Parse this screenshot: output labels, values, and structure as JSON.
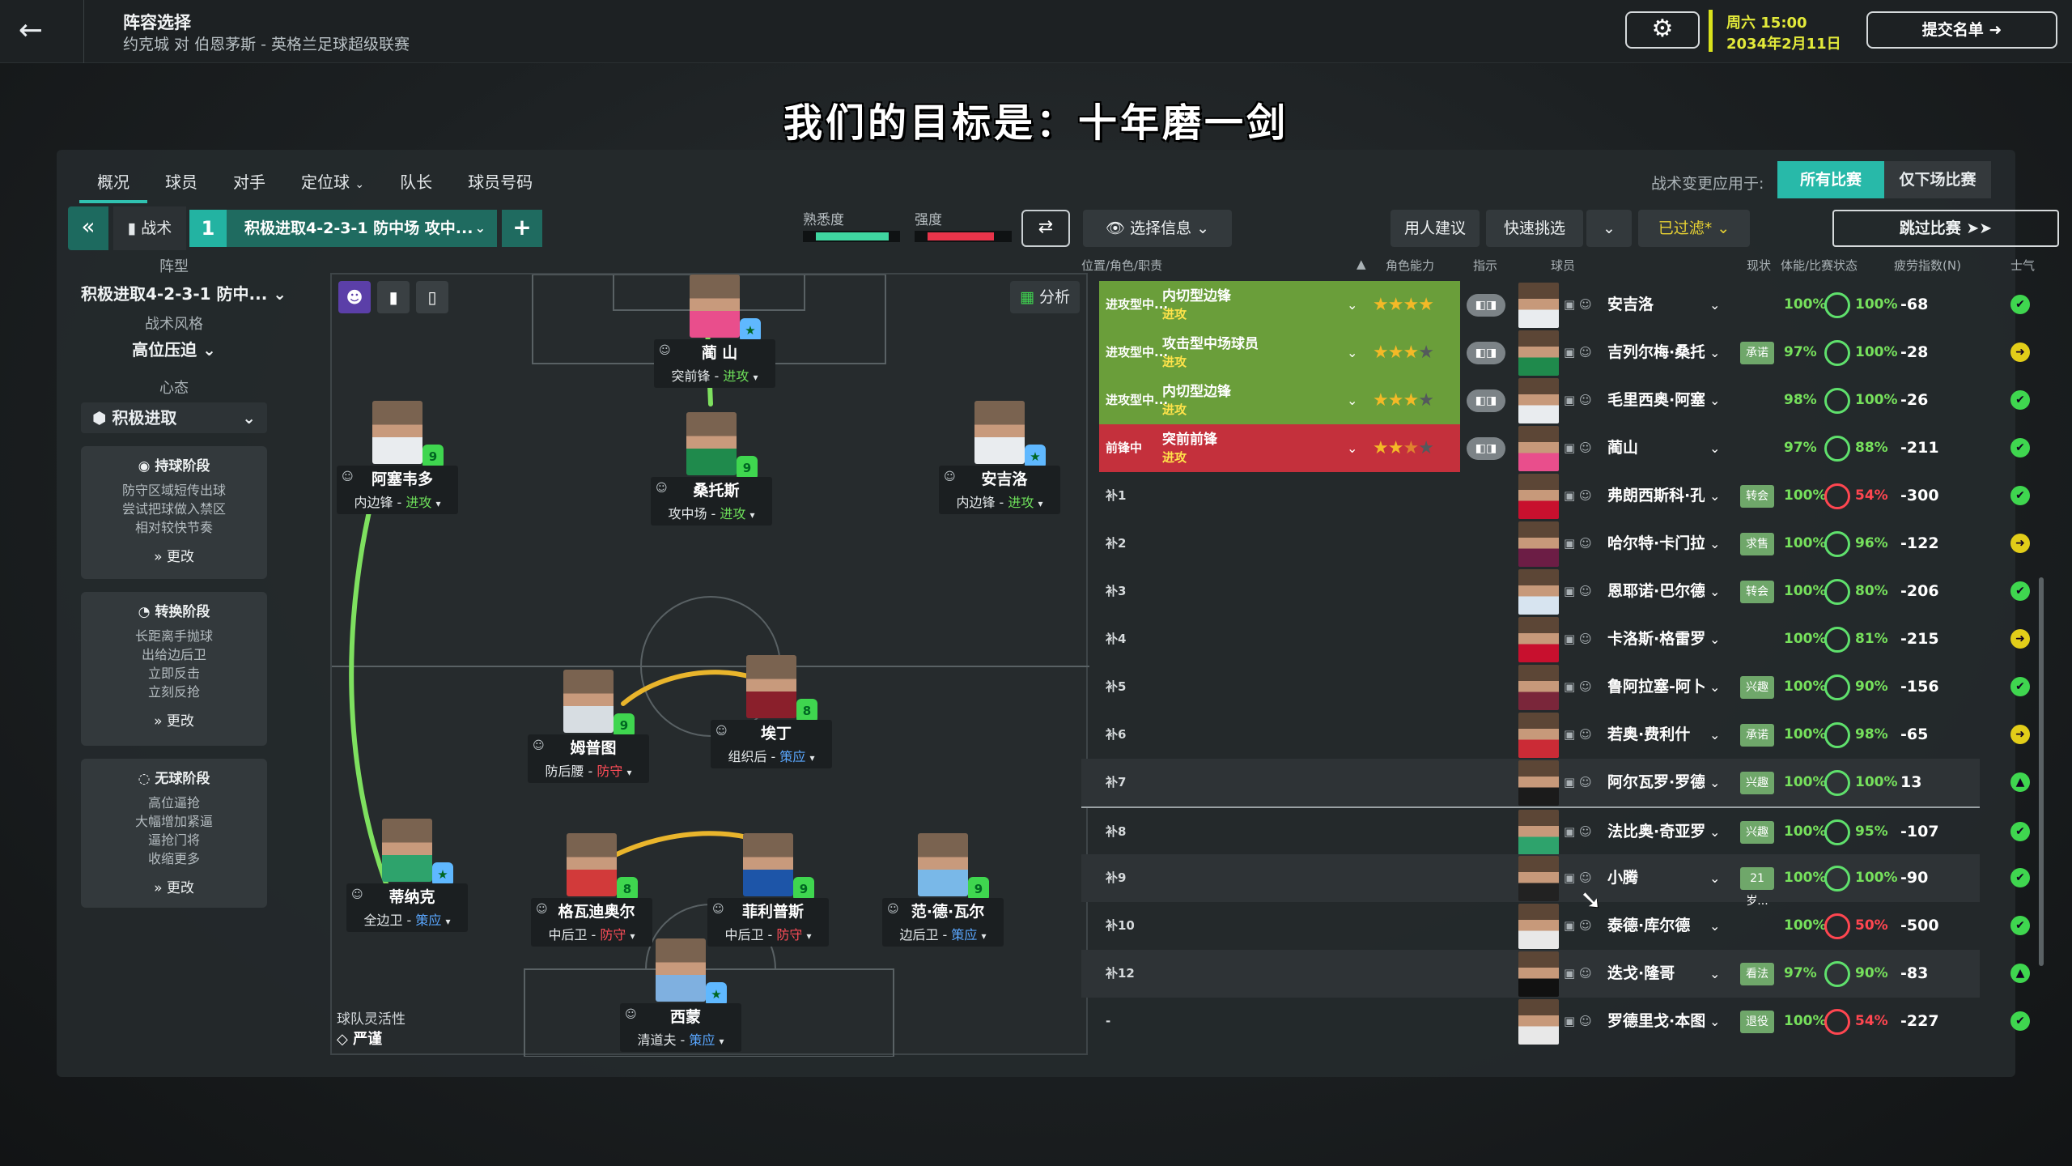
{
  "header": {
    "title": "阵容选择",
    "subtitle": "约克城 对 伯恩茅斯 - 英格兰足球超级联赛",
    "date_time": "周六 15:00",
    "date": "2034年2月11日",
    "submit_label": "提交名单",
    "icons": [
      "back-arrow-icon",
      "gear-icon",
      "arrow-right-circle-icon"
    ]
  },
  "motto": "我们的目标是：十年磨一剑",
  "tabs": [
    "概况",
    "球员",
    "对手",
    "定位球",
    "队长",
    "球员号码"
  ],
  "tabs_chevron": "⌄",
  "apply_label": "战术变更应用于:",
  "apply_options": [
    "所有比赛",
    "仅下场比赛"
  ],
  "toolbar": {
    "tactic_label": "战术",
    "tactic_number": "1",
    "tactic_name": "积极进取4-2-3-1 防中场 攻中...",
    "familiarity_label": "熟悉度",
    "intensity_label": "强度",
    "familiarity_level": 0.9,
    "intensity_level": 0.82,
    "info_label": "选择信息",
    "suggest_label": "用人建议",
    "quick_pick_label": "快速挑选",
    "filter_label": "已过滤*",
    "skip_label": "跳过比赛"
  },
  "sidebar": {
    "formation_heading": "阵型",
    "formation": "积极进取4-2-3-1 防中...",
    "style_heading": "战术风格",
    "style": "高位压迫",
    "mentality_heading": "心态",
    "mentality": "积极进取",
    "phases": [
      {
        "title": "持球阶段",
        "lines": [
          "防守区域短传出球",
          "尝试把球做入禁区",
          "相对较快节奏"
        ],
        "more": "更改"
      },
      {
        "title": "转换阶段",
        "lines": [
          "长距离手抛球",
          "出给边后卫",
          "立即反击",
          "立刻反抢"
        ],
        "more": "更改"
      },
      {
        "title": "无球阶段",
        "lines": [
          "高位逼抢",
          "大幅增加紧逼",
          "逼抢门将",
          "收缩更多"
        ],
        "more": "更改"
      }
    ]
  },
  "pitch": {
    "analyse_label": "分析",
    "flex_label": "球队灵活性",
    "flex_value": "严谨",
    "players": [
      {
        "name": "蔺 山",
        "role": "突前锋",
        "duty": "进攻",
        "duty_type": "att",
        "badge": "★",
        "badge_color": "#5fb8ff",
        "shirt": "#e94e8c"
      },
      {
        "name": "阿塞韦多",
        "role": "内边锋",
        "duty": "进攻",
        "duty_type": "att",
        "badge": "9",
        "badge_color": "#3fd64f",
        "shirt": "#e9ecef"
      },
      {
        "name": "桑托斯",
        "role": "攻中场",
        "duty": "进攻",
        "duty_type": "att",
        "badge": "9",
        "badge_color": "#3fd64f",
        "shirt": "#1f8a4c"
      },
      {
        "name": "安吉洛",
        "role": "内边锋",
        "duty": "进攻",
        "duty_type": "att",
        "badge": "★",
        "badge_color": "#5fb8ff",
        "shirt": "#e9ecef"
      },
      {
        "name": "姆普图",
        "role": "防后腰",
        "duty": "防守",
        "duty_type": "def",
        "badge": "9",
        "badge_color": "#3fd64f",
        "shirt": "#d7dde2"
      },
      {
        "name": "埃丁",
        "role": "组织后",
        "duty": "策应",
        "duty_type": "sup",
        "badge": "8",
        "badge_color": "#3fd64f",
        "shirt": "#8a1f2b"
      },
      {
        "name": "蒂纳克",
        "role": "全边卫",
        "duty": "策应",
        "duty_type": "sup",
        "badge": "★",
        "badge_color": "#5fb8ff",
        "shirt": "#2ea36c"
      },
      {
        "name": "格瓦迪奥尔",
        "role": "中后卫",
        "duty": "防守",
        "duty_type": "def",
        "badge": "8",
        "badge_color": "#3fd64f",
        "shirt": "#d23a3a"
      },
      {
        "name": "菲利普斯",
        "role": "中后卫",
        "duty": "防守",
        "duty_type": "def",
        "badge": "9",
        "badge_color": "#3fd64f",
        "shirt": "#1d55a8"
      },
      {
        "name": "范·德·瓦尔",
        "role": "边后卫",
        "duty": "策应",
        "duty_type": "sup",
        "badge": "9",
        "badge_color": "#3fd64f",
        "shirt": "#79b8e8"
      },
      {
        "name": "西蒙",
        "role": "清道夫",
        "duty": "策应",
        "duty_type": "sup",
        "badge": "★",
        "badge_color": "#5fb8ff",
        "shirt": "#7fb0e0"
      }
    ]
  },
  "list": {
    "headers": [
      "位置/角色/职责",
      "角色能力",
      "指示",
      "球员",
      "现状",
      "体能/比赛状态",
      "疲劳指数(N)",
      "士气"
    ],
    "rows": [
      {
        "code": "进攻型中...",
        "role": "内切型边锋",
        "duty": "进攻",
        "slot_color": "#6a9e3a",
        "stars": 4,
        "half": false,
        "instr": "◧◨",
        "player": "安吉洛",
        "status": "",
        "fitness": "100%",
        "match": "100%",
        "match_low": false,
        "sharp": "-68",
        "morale": "yes",
        "shirt": "#e9ecef"
      },
      {
        "code": "进攻型中...",
        "role": "攻击型中场球员",
        "duty": "进攻",
        "slot_color": "#6a9e3a",
        "stars": 3,
        "half": false,
        "instr": "◧◨",
        "player": "吉列尔梅·桑托斯",
        "status": "承诺",
        "fitness": "97%",
        "match": "100%",
        "match_low": false,
        "sharp": "-28",
        "morale": "neutral",
        "shirt": "#1f8a4c"
      },
      {
        "code": "进攻型中...",
        "role": "内切型边锋",
        "duty": "进攻",
        "slot_color": "#6a9e3a",
        "stars": 3,
        "half": false,
        "instr": "◧◨",
        "player": "毛里西奥·阿塞韦多",
        "status": "",
        "fitness": "98%",
        "match": "100%",
        "match_low": false,
        "sharp": "-26",
        "morale": "yes",
        "shirt": "#e9ecef"
      },
      {
        "code": "前锋中",
        "role": "突前前锋",
        "duty": "进攻",
        "slot_color": "#c4303c",
        "stars": 2,
        "half": true,
        "instr": "◧◨",
        "player": "蔺山",
        "status": "",
        "fitness": "97%",
        "match": "88%",
        "match_low": false,
        "sharp": "-211",
        "morale": "yes",
        "shirt": "#e94e8c"
      },
      {
        "code": "补1",
        "player": "弗朗西斯科·孔塞桑",
        "status": "转会",
        "fitness": "100%",
        "match": "54%",
        "match_low": true,
        "sharp": "-300",
        "morale": "yes",
        "shirt": "#c8102e"
      },
      {
        "code": "补2",
        "player": "哈尔特·卡门拉",
        "status": "求售",
        "fitness": "100%",
        "match": "96%",
        "match_low": false,
        "sharp": "-122",
        "morale": "neutral",
        "shirt": "#6c1d45"
      },
      {
        "code": "补3",
        "player": "恩耶诺·巴尔德",
        "status": "转会",
        "fitness": "100%",
        "match": "80%",
        "match_low": false,
        "sharp": "-206",
        "morale": "yes",
        "shirt": "#d7e4f0"
      },
      {
        "code": "补4",
        "player": "卡洛斯·格雷罗",
        "status": "",
        "fitness": "100%",
        "match": "81%",
        "match_low": false,
        "sharp": "-215",
        "morale": "neutral",
        "shirt": "#c8102e"
      },
      {
        "code": "补5",
        "player": "鲁阿拉塞-阿卜杜拉赫曼",
        "status": "兴趣",
        "fitness": "100%",
        "match": "90%",
        "match_low": false,
        "sharp": "-156",
        "morale": "yes",
        "shirt": "#7a263a"
      },
      {
        "code": "补6",
        "player": "若奥·费利什",
        "status": "承诺",
        "fitness": "100%",
        "match": "98%",
        "match_low": false,
        "sharp": "-65",
        "morale": "neutral",
        "shirt": "#cb2b36"
      },
      {
        "code": "补7",
        "player": "阿尔瓦罗·罗德里格斯·鲁...",
        "status": "兴趣",
        "fitness": "100%",
        "match": "100%",
        "match_low": false,
        "sharp": "13",
        "morale": "up",
        "shirt": "#1b1b1b"
      },
      {
        "code": "补8",
        "player": "法比奥·奇亚罗莫拉",
        "status": "兴趣",
        "fitness": "100%",
        "match": "95%",
        "match_low": false,
        "sharp": "-107",
        "morale": "yes",
        "shirt": "#2ea36c"
      },
      {
        "code": "补9",
        "player": "小腾",
        "status": "21岁...",
        "fitness": "100%",
        "match": "100%",
        "match_low": false,
        "sharp": "-90",
        "morale": "yes",
        "shirt": "#222"
      },
      {
        "code": "补10",
        "player": "泰德·库尔德",
        "status": "",
        "fitness": "100%",
        "match": "50%",
        "match_low": true,
        "sharp": "-500",
        "morale": "yes",
        "shirt": "#e8e8e8"
      },
      {
        "code": "补12",
        "player": "迭戈·隆哥",
        "status": "看法",
        "fitness": "97%",
        "match": "90%",
        "match_low": false,
        "sharp": "-83",
        "morale": "up",
        "shirt": "#111"
      },
      {
        "code": "-",
        "player": "罗德里戈·本图尔",
        "status": "退役",
        "fitness": "100%",
        "match": "54%",
        "match_low": true,
        "sharp": "-227",
        "morale": "yes",
        "shirt": "#e8e8e8"
      }
    ]
  }
}
